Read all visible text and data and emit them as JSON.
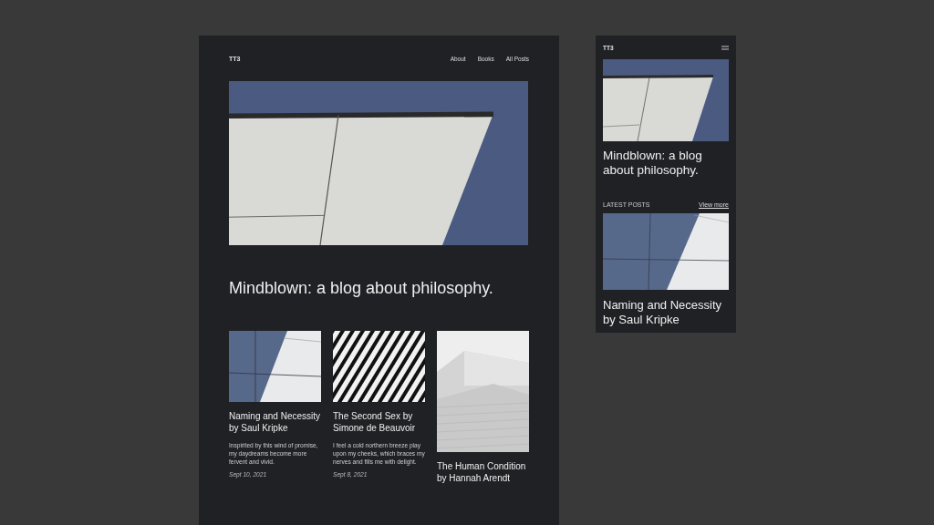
{
  "desktop": {
    "site_title": "TT3",
    "nav": [
      "About",
      "Books",
      "All Posts"
    ],
    "heading": "Mindblown: a blog about philosophy.",
    "posts": [
      {
        "kind": "facade",
        "title": "Naming and Necessity by Saul Kripke",
        "excerpt": "Inspirited by this wind of promise, my daydreams become more fervent and vivid.",
        "date": "Sept 10, 2021"
      },
      {
        "kind": "stripes",
        "title": "The Second Sex by Simone de Beauvoir",
        "excerpt": "I feel a cold northern breeze play upon my cheeks, which braces my nerves and fills me with delight.",
        "date": "Sept 8, 2021"
      },
      {
        "kind": "building",
        "title": "The Human Condition by Hannah Arendt"
      }
    ]
  },
  "mobile": {
    "site_title": "TT3",
    "heading": "Mindblown: a blog about philosophy.",
    "section_label": "LATEST POSTS",
    "link": "View more",
    "post": {
      "kind": "facade",
      "title": "Naming and Necessity by Saul Kripke"
    }
  }
}
